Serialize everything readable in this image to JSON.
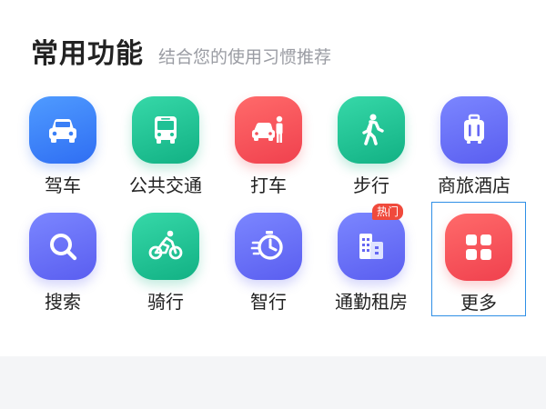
{
  "section": {
    "title": "常用功能",
    "subtitle": "结合您的使用习惯推荐"
  },
  "rows": [
    [
      {
        "label": "驾车",
        "icon": "car-icon",
        "color": "#3a7ff6"
      },
      {
        "label": "公共交通",
        "icon": "bus-icon",
        "color": "#1fc195"
      },
      {
        "label": "打车",
        "icon": "taxi-icon",
        "color": "#f4515b"
      },
      {
        "label": "步行",
        "icon": "walk-icon",
        "color": "#1fc195"
      },
      {
        "label": "商旅酒店",
        "icon": "luggage-icon",
        "color": "#6567f3"
      }
    ],
    [
      {
        "label": "搜索",
        "icon": "search-icon",
        "color": "#6567f3"
      },
      {
        "label": "骑行",
        "icon": "bike-icon",
        "color": "#1fc195"
      },
      {
        "label": "智行",
        "icon": "timer-icon",
        "color": "#6567f3"
      },
      {
        "label": "通勤租房",
        "icon": "building-icon",
        "color": "#6567f3",
        "badge": "热门"
      },
      {
        "label": "更多",
        "icon": "grid-icon",
        "color": "#f4515b",
        "selected": true
      }
    ]
  ]
}
